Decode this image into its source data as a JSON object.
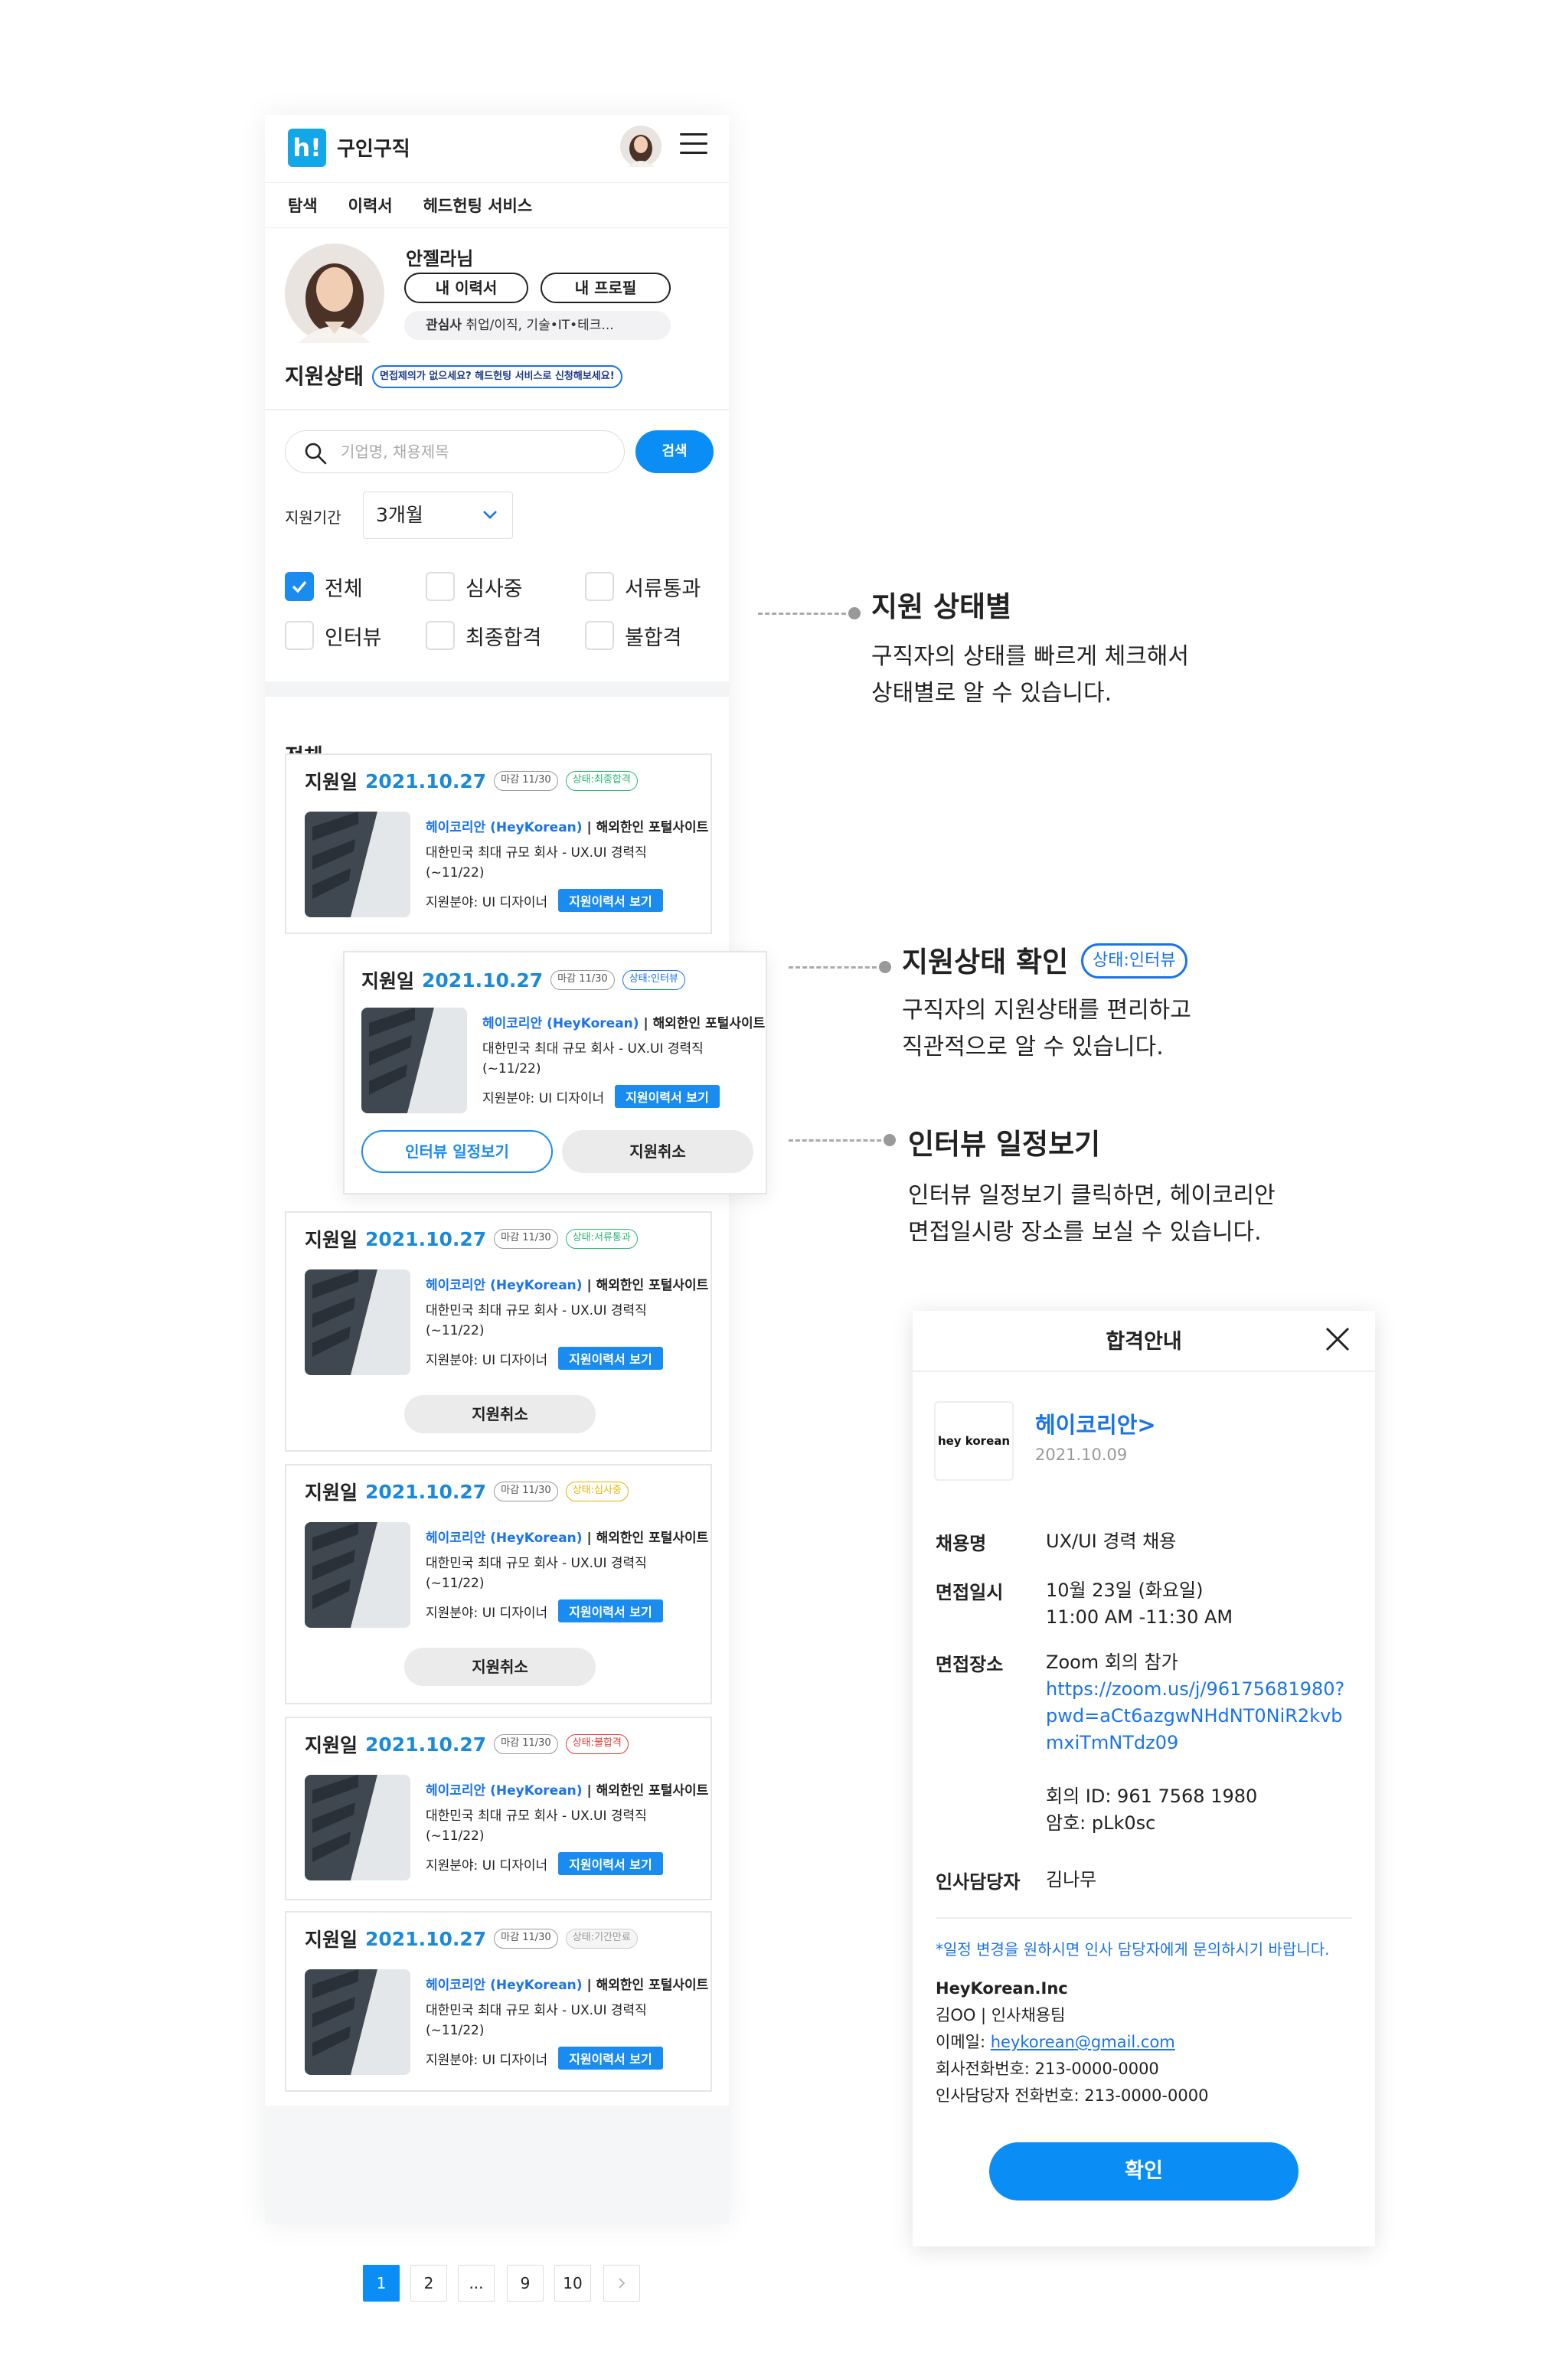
{
  "app": {
    "title": "구인구직",
    "logo_text": "h!"
  },
  "nav": [
    "탐색",
    "이력서",
    "헤드헌팅 서비스"
  ],
  "profile": {
    "name": "안젤라님",
    "resume_btn": "내 이력서",
    "profile_btn": "내 프로필",
    "interest_label": "관심사",
    "interest_value": "취업/이직, 기술•IT•테크..."
  },
  "status_section": {
    "title": "지원상태",
    "note": "면접제의가 없으세요? 헤드헌팅 서비스로 신청해보세요!"
  },
  "search": {
    "placeholder": "기업명, 채용제목",
    "button": "검색"
  },
  "filter": {
    "period_label": "지원기간",
    "period_value": "3개월",
    "checkboxes": [
      {
        "label": "전체",
        "checked": true
      },
      {
        "label": "심사중",
        "checked": false
      },
      {
        "label": "서류통과",
        "checked": false
      },
      {
        "label": "인터뷰",
        "checked": false
      },
      {
        "label": "최종합격",
        "checked": false
      },
      {
        "label": "불합격",
        "checked": false
      }
    ]
  },
  "list": {
    "title": "전체",
    "apply_label": "지원일",
    "company_name": "헤이코리안 (HeyKorean)",
    "company_desc": "| 해외한인 포털사이트",
    "job_line1": "대한민국 최대 규모 회사 - UX.UI 경력직",
    "job_line2": "(~11/22)",
    "field_label": "지원분야: UI 디자이너",
    "view_btn": "지원이력서 보기",
    "cancel_btn": "지원취소",
    "cards": [
      {
        "date": "2021.10.27",
        "deadline": "마감 11/30",
        "status": "상태:최종합격",
        "status_color": "#2bb673"
      },
      {
        "date": "2021.10.27",
        "deadline": "마감 11/30",
        "status": "상태:서류통과",
        "status_color": "#2bb673"
      },
      {
        "date": "2021.10.27",
        "deadline": "마감 11/30",
        "status": "상태:심사중",
        "status_color": "#e8b400"
      },
      {
        "date": "2021.10.27",
        "deadline": "마감 11/30",
        "status": "상태:불합격",
        "status_color": "#e53935"
      },
      {
        "date": "2021.10.27",
        "deadline": "마감 11/30",
        "status": "상태:기간만료",
        "status_color": "#aaaaaa"
      }
    ],
    "popup": {
      "date": "2021.10.27",
      "deadline": "마감 11/30",
      "status": "상태:인터뷰",
      "status_color": "#1a73e8",
      "interview_btn": "인터뷰 일정보기",
      "cancel_btn": "지원취소"
    }
  },
  "pagination": {
    "pages": [
      "1",
      "2",
      "...",
      "9",
      "10"
    ],
    "current": "1"
  },
  "annotations": [
    {
      "title": "지원 상태별",
      "lines": [
        "구직자의 상태를 빠르게 체크해서",
        "상태별로  알 수 있습니다."
      ]
    },
    {
      "title": "지원상태 확인",
      "badge": "상태:인터뷰",
      "lines": [
        "구직자의 지원상태를 편리하고",
        "직관적으로 알 수 있습니다."
      ]
    },
    {
      "title": "인터뷰 일정보기",
      "lines": [
        "인터뷰 일정보기 클릭하면, 헤이코리안",
        "면접일시랑 장소를 보실 수 있습니다."
      ]
    }
  ],
  "modal": {
    "title": "합격안내",
    "logo_text": "hey korean",
    "company": "헤이코리안>",
    "date": "2021.10.09",
    "rows": [
      {
        "label": "채용명",
        "lines": [
          "UX/UI 경력 채용"
        ]
      },
      {
        "label": "면접일시",
        "lines": [
          "10월 23일 (화요일)",
          "11:00 AM -11:30 AM"
        ]
      },
      {
        "label": "면접장소",
        "lines": [
          "Zoom 회의 참가",
          "https://zoom.us/j/96175681980?",
          "pwd=aCt6azgwNHdNT0NiR2kvb",
          "mxiTmNTdz09",
          "",
          "회의 ID: 961 7568 1980",
          "암호: pLk0sc"
        ]
      },
      {
        "label": "인사담당자",
        "lines": [
          "김나무"
        ]
      }
    ],
    "note": "*일정 변경을 원하시면 인사 담당자에게 문의하시기 바랍니다.",
    "footer": {
      "company": "HeyKorean.Inc",
      "team": "김OO | 인사채용팀",
      "email_label": "이메일: ",
      "email": "heykorean@gmail.com",
      "phone": "회사전화번호: 213-0000-0000",
      "hr_phone": "인사담당자 전화번호: 213-0000-0000"
    },
    "confirm": "확인"
  }
}
